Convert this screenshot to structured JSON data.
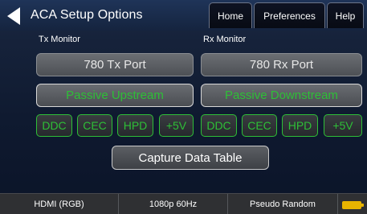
{
  "header": {
    "title": "ACA Setup Options",
    "tabs": [
      {
        "label": "Home"
      },
      {
        "label": "Preferences"
      },
      {
        "label": "Help"
      }
    ]
  },
  "tx": {
    "label": "Tx Monitor",
    "port_button": "780 Tx Port",
    "passive_button": "Passive Upstream",
    "signals": [
      "DDC",
      "CEC",
      "HPD",
      "+5V"
    ]
  },
  "rx": {
    "label": "Rx Monitor",
    "port_button": "780 Rx Port",
    "passive_button": "Passive Downstream",
    "signals": [
      "DDC",
      "CEC",
      "HPD",
      "+5V"
    ]
  },
  "capture_button": "Capture Data Table",
  "statusbar": {
    "video_format": "HDMI (RGB)",
    "timing": "1080p 60Hz",
    "pattern": "Pseudo Random",
    "battery_icon": "battery-icon"
  },
  "colors": {
    "accent_green": "#2ebf37",
    "battery": "#e8b400",
    "header_bg": "#1f3458"
  }
}
